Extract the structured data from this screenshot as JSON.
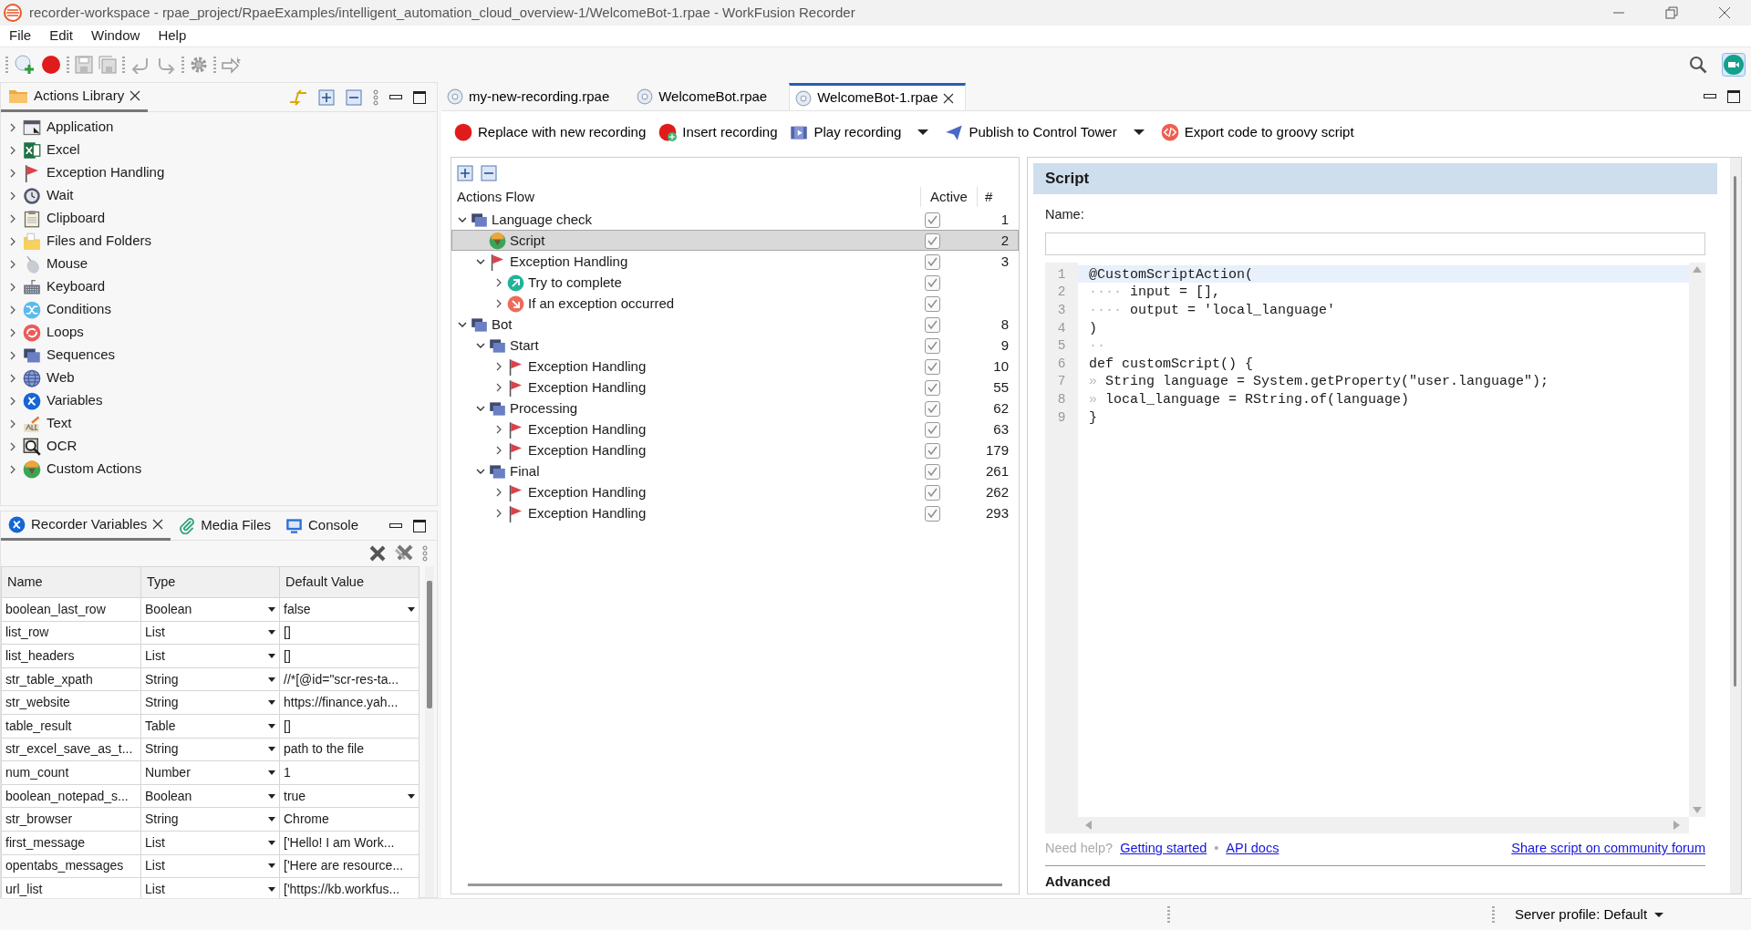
{
  "window": {
    "title": "recorder-workspace - rpae_project/RpaeExamples/intelligent_automation_cloud_overview-1/WelcomeBot-1.rpae - WorkFusion Recorder"
  },
  "menu": [
    "File",
    "Edit",
    "Window",
    "Help"
  ],
  "actions_library": {
    "title": "Actions Library",
    "items": [
      {
        "label": "Application",
        "kind": "application"
      },
      {
        "label": "Excel",
        "kind": "excel"
      },
      {
        "label": "Exception Handling",
        "kind": "exception"
      },
      {
        "label": "Wait",
        "kind": "wait"
      },
      {
        "label": "Clipboard",
        "kind": "clipboard"
      },
      {
        "label": "Files and Folders",
        "kind": "files"
      },
      {
        "label": "Mouse",
        "kind": "mouse"
      },
      {
        "label": "Keyboard",
        "kind": "keyboard"
      },
      {
        "label": "Conditions",
        "kind": "conditions"
      },
      {
        "label": "Loops",
        "kind": "loops"
      },
      {
        "label": "Sequences",
        "kind": "sequences"
      },
      {
        "label": "Web",
        "kind": "web"
      },
      {
        "label": "Variables",
        "kind": "variables"
      },
      {
        "label": "Text",
        "kind": "text"
      },
      {
        "label": "OCR",
        "kind": "ocr"
      },
      {
        "label": "Custom Actions",
        "kind": "custom"
      }
    ]
  },
  "bottom_tabs": [
    {
      "label": "Recorder Variables",
      "kind": "variables",
      "selected": true
    },
    {
      "label": "Media Files",
      "kind": "clip",
      "selected": false
    },
    {
      "label": "Console",
      "kind": "console",
      "selected": false
    }
  ],
  "variables_table": {
    "columns": [
      "Name",
      "Type",
      "Default Value"
    ],
    "rows": [
      {
        "name": "boolean_last_row",
        "type": "Boolean",
        "value": "false",
        "value_dropdown": true
      },
      {
        "name": "list_row",
        "type": "List",
        "value": "[]",
        "value_dropdown": false
      },
      {
        "name": "list_headers",
        "type": "List",
        "value": "[]",
        "value_dropdown": false
      },
      {
        "name": "str_table_xpath",
        "type": "String",
        "value": "//*[@id=\"scr-res-ta...",
        "value_dropdown": false
      },
      {
        "name": "str_website",
        "type": "String",
        "value": "https://finance.yah...",
        "value_dropdown": false
      },
      {
        "name": "table_result",
        "type": "Table",
        "value": "[]",
        "value_dropdown": false
      },
      {
        "name": "str_excel_save_as_t...",
        "type": "String",
        "value": "path to the file",
        "value_dropdown": false
      },
      {
        "name": "num_count",
        "type": "Number",
        "value": "1",
        "value_dropdown": false
      },
      {
        "name": "boolean_notepad_s...",
        "type": "Boolean",
        "value": "true",
        "value_dropdown": true
      },
      {
        "name": "str_browser",
        "type": "String",
        "value": "Chrome",
        "value_dropdown": false
      },
      {
        "name": "first_message",
        "type": "List",
        "value": "['Hello! I am Work...",
        "value_dropdown": false
      },
      {
        "name": "opentabs_messages",
        "type": "List",
        "value": "['Here are resource...",
        "value_dropdown": false
      },
      {
        "name": "url_list",
        "type": "List",
        "value": "['https://kb.workfus...",
        "value_dropdown": false
      }
    ]
  },
  "editor_tabs": [
    {
      "label": "my-new-recording.rpae",
      "selected": false
    },
    {
      "label": "WelcomeBot.rpae",
      "selected": false
    },
    {
      "label": "WelcomeBot-1.rpae",
      "selected": true
    }
  ],
  "editor_toolbar": [
    {
      "label": "Replace with new recording",
      "kind": "record",
      "dropdown": false
    },
    {
      "label": "Insert recording",
      "kind": "insert",
      "dropdown": false
    },
    {
      "label": "Play recording",
      "kind": "play",
      "dropdown": true
    },
    {
      "label": "Publish to Control Tower",
      "kind": "publish",
      "dropdown": true
    },
    {
      "label": "Export code to groovy script",
      "kind": "export",
      "dropdown": false
    }
  ],
  "actions_flow": {
    "columns": [
      "Actions Flow",
      "Active",
      "#"
    ],
    "items": [
      {
        "label": "Language check",
        "kind": "sequences",
        "active": true,
        "number": "1",
        "selected": false,
        "expanded": true,
        "children": [
          {
            "label": "Script",
            "kind": "custom",
            "active": true,
            "number": "2",
            "selected": true
          },
          {
            "label": "Exception Handling",
            "kind": "exception",
            "active": true,
            "number": "3",
            "selected": false,
            "expanded": true,
            "children": [
              {
                "label": "Try to complete",
                "kind": "try",
                "active": true,
                "selected": false,
                "expanded": false
              },
              {
                "label": "If an exception occurred",
                "kind": "catch",
                "active": true,
                "selected": false,
                "expanded": false
              }
            ]
          }
        ]
      },
      {
        "label": "Bot",
        "kind": "sequences",
        "active": true,
        "number": "8",
        "selected": false,
        "expanded": true,
        "children": [
          {
            "label": "Start",
            "kind": "sequences",
            "active": true,
            "number": "9",
            "selected": false,
            "expanded": true,
            "children": [
              {
                "label": "Exception Handling",
                "kind": "exception",
                "active": true,
                "number": "10",
                "selected": false,
                "expanded": false
              },
              {
                "label": "Exception Handling",
                "kind": "exception",
                "active": true,
                "number": "55",
                "selected": false,
                "expanded": false
              }
            ]
          },
          {
            "label": "Processing",
            "kind": "sequences",
            "active": true,
            "number": "62",
            "selected": false,
            "expanded": true,
            "children": [
              {
                "label": "Exception Handling",
                "kind": "exception",
                "active": true,
                "number": "63",
                "selected": false,
                "expanded": false
              },
              {
                "label": "Exception Handling",
                "kind": "exception",
                "active": true,
                "number": "179",
                "selected": false,
                "expanded": false
              }
            ]
          },
          {
            "label": "Final",
            "kind": "sequences",
            "active": true,
            "number": "261",
            "selected": false,
            "expanded": true,
            "children": [
              {
                "label": "Exception Handling",
                "kind": "exception",
                "active": true,
                "number": "262",
                "selected": false,
                "expanded": false
              },
              {
                "label": "Exception Handling",
                "kind": "exception",
                "active": true,
                "number": "293",
                "selected": false,
                "expanded": false
              }
            ]
          }
        ]
      }
    ]
  },
  "script_panel": {
    "title": "Script",
    "name_label": "Name:",
    "code": [
      {
        "number": "1",
        "code": "@CustomScriptAction(",
        "current": true
      },
      {
        "number": "2",
        "indent": "····",
        "code": "input = [],",
        "current": false
      },
      {
        "number": "3",
        "indent": "····",
        "code": "output = 'local_language'",
        "current": false
      },
      {
        "number": "4",
        "code": ")",
        "current": false
      },
      {
        "number": "5",
        "indent": "··",
        "current": false
      },
      {
        "number": "6",
        "code": "def customScript() {",
        "current": false
      },
      {
        "number": "7",
        "indent": "»",
        "code": "String language = System.getProperty(\"user.language\");",
        "current": false
      },
      {
        "number": "8",
        "indent": "»",
        "code": "local_language = RString.of(language)",
        "current": false
      },
      {
        "number": "9",
        "code": "}",
        "current": false
      }
    ],
    "help_label": "Need help?",
    "help_links": [
      "Getting started",
      "API docs"
    ],
    "separator": "•",
    "share_link": "Share script on community forum",
    "section": "Advanced"
  },
  "status_bar": {
    "server_profile": "Server profile: Default"
  }
}
